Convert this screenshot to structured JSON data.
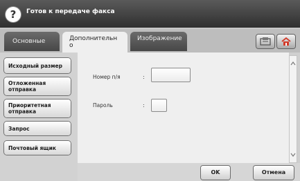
{
  "header": {
    "help_icon": "help-icon",
    "help_glyph": "?",
    "status": "Готов к передаче факса"
  },
  "tabs": [
    {
      "label": "Основные",
      "active": false
    },
    {
      "label": "Дополнительно",
      "active": true
    },
    {
      "label": "Изображение",
      "active": false
    }
  ],
  "toolbar": {
    "favorites_icon": "favorites-icon",
    "home_icon": "home-icon"
  },
  "sidebar": {
    "items": [
      {
        "label": "Исходный размер"
      },
      {
        "label": "Отложенная отправка"
      },
      {
        "label": "Приоритетная отправка"
      },
      {
        "label": "Запрос"
      },
      {
        "label": "Почтовый ящик"
      }
    ]
  },
  "form": {
    "number_label": "Номер п/я",
    "number_value": "",
    "password_label": "Пароль",
    "password_value": "",
    "separator": ":"
  },
  "actions": {
    "ok_label": "OK",
    "cancel_label": "Отмена"
  },
  "colors": {
    "header_bg": "#3a3a3a",
    "active_tab_bg": "#efefef",
    "inactive_tab_bg": "#555555",
    "content_bg": "#efefef"
  }
}
